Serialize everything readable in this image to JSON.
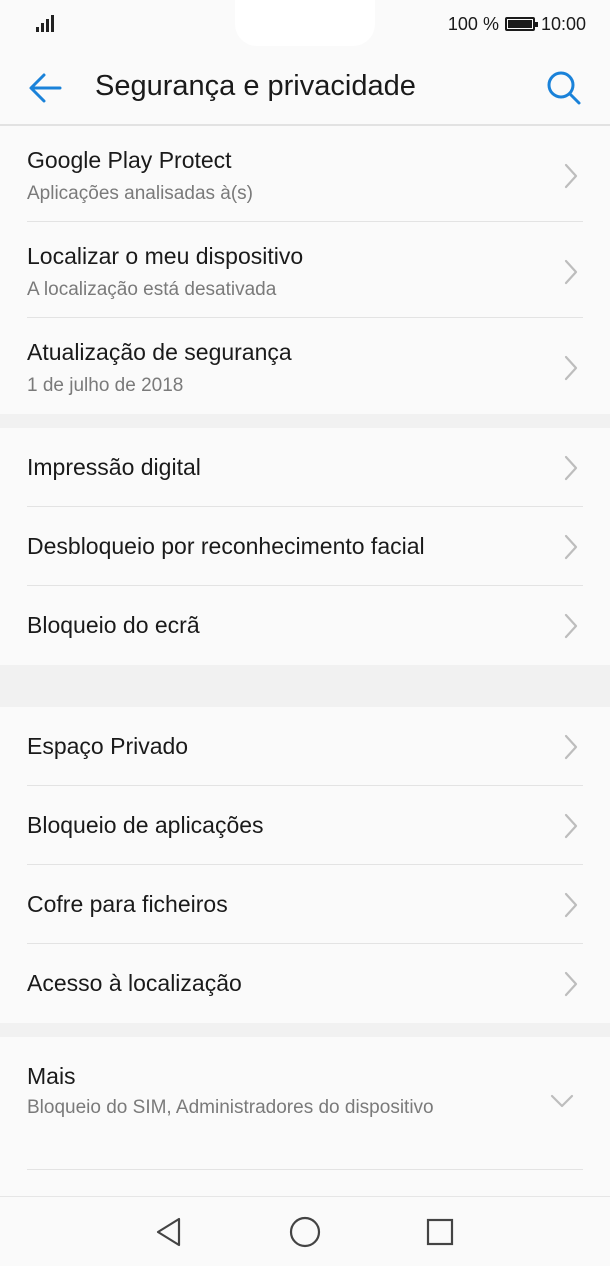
{
  "status_bar": {
    "battery_text": "100 %",
    "time": "10:00"
  },
  "app_bar": {
    "title": "Segurança e privacidade",
    "back_icon": "arrow-left-icon",
    "search_icon": "search-icon"
  },
  "accent_color": "#1a82d9",
  "groups": [
    {
      "items": [
        {
          "label": "Google Play Protect",
          "sub": "Aplicações analisadas à(s)"
        },
        {
          "label": "Localizar o meu dispositivo",
          "sub": "A localização está desativada"
        },
        {
          "label": "Atualização de segurança",
          "sub": "1 de julho de 2018"
        }
      ]
    },
    {
      "items": [
        {
          "label": "Impressão digital"
        },
        {
          "label": "Desbloqueio por reconhecimento facial"
        },
        {
          "label": "Bloqueio do ecrã"
        }
      ]
    },
    {
      "items": [
        {
          "label": "Espaço Privado"
        },
        {
          "label": "Bloqueio de aplicações"
        },
        {
          "label": "Cofre para ficheiros"
        },
        {
          "label": "Acesso à localização"
        }
      ]
    },
    {
      "items": [
        {
          "label": "Mais",
          "sub": "Bloqueio do SIM, Administradores do dispositivo"
        }
      ]
    }
  ],
  "nav_bar": {
    "back_icon": "triangle-back-icon",
    "home_icon": "circle-home-icon",
    "recents_icon": "square-recents-icon"
  }
}
